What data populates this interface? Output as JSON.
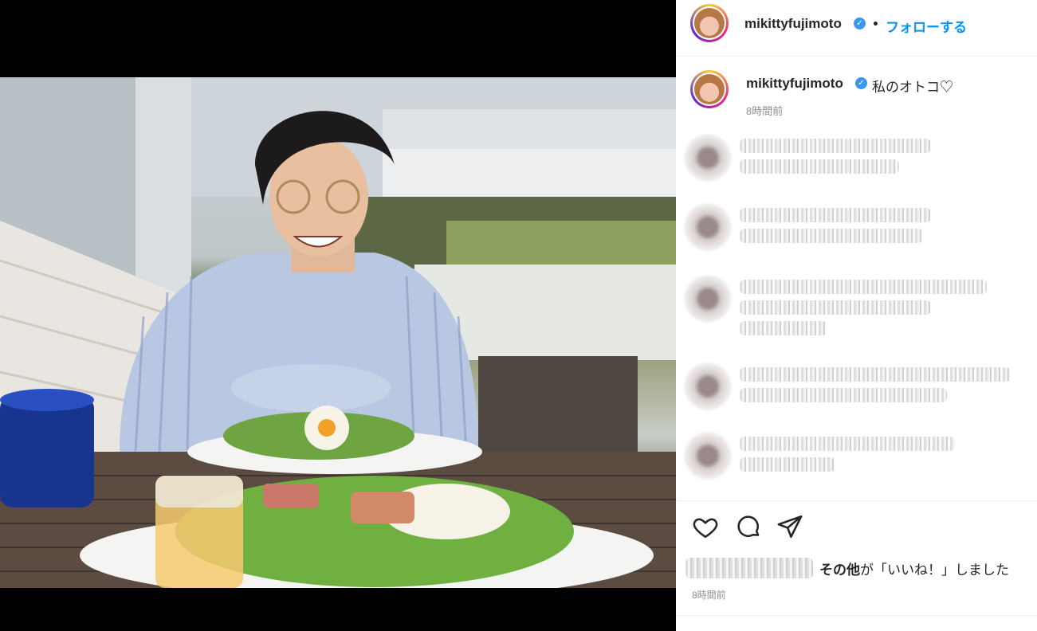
{
  "post": {
    "username": "mikittyfujimoto",
    "follow_label": "フォローする",
    "separator": "•",
    "caption": "私のオトコ♡",
    "caption_time": "8時間前",
    "likes_bold": "その他",
    "likes_suffix": "が「いいね！」しました",
    "post_time": "8時間前"
  },
  "icons": {
    "like": "heart-icon",
    "comment": "comment-icon",
    "share": "paper-plane-icon",
    "verified": "verified-badge-icon"
  },
  "colors": {
    "accent": "#0095f6",
    "verified": "#3897f0",
    "text": "#262626",
    "muted": "#8e8e8e"
  }
}
